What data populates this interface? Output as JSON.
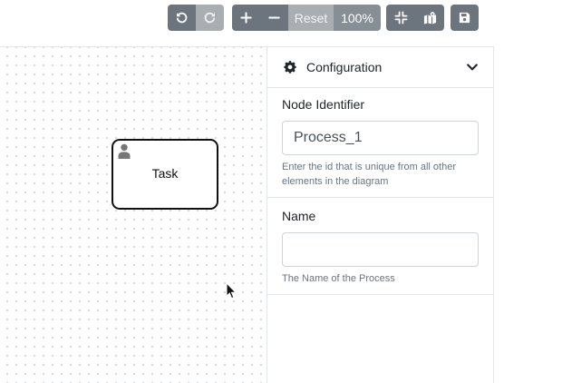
{
  "toolbar": {
    "undo_icon": "undo-icon",
    "redo_icon": "redo-icon",
    "zoom_in_icon": "plus-icon",
    "zoom_out_icon": "minus-icon",
    "reset_label": "Reset",
    "zoom_level": "100%",
    "fit_icon": "compress-icon",
    "minimap_icon": "map-icon",
    "save_icon": "save-icon"
  },
  "canvas": {
    "task": {
      "label": "Task",
      "icon": "user-icon"
    }
  },
  "panel": {
    "title": "Configuration",
    "fields": [
      {
        "label": "Node Identifier",
        "value": "Process_1",
        "help": "Enter the id that is unique from all other elements in the diagram"
      },
      {
        "label": "Name",
        "value": "",
        "help": "The Name of the Process"
      }
    ]
  },
  "colors": {
    "button": "#6c757d",
    "button_disabled": "#a9aeb3",
    "border": "#e3e6e9",
    "input_border": "#ced4da",
    "help_text": "#6c757d"
  }
}
